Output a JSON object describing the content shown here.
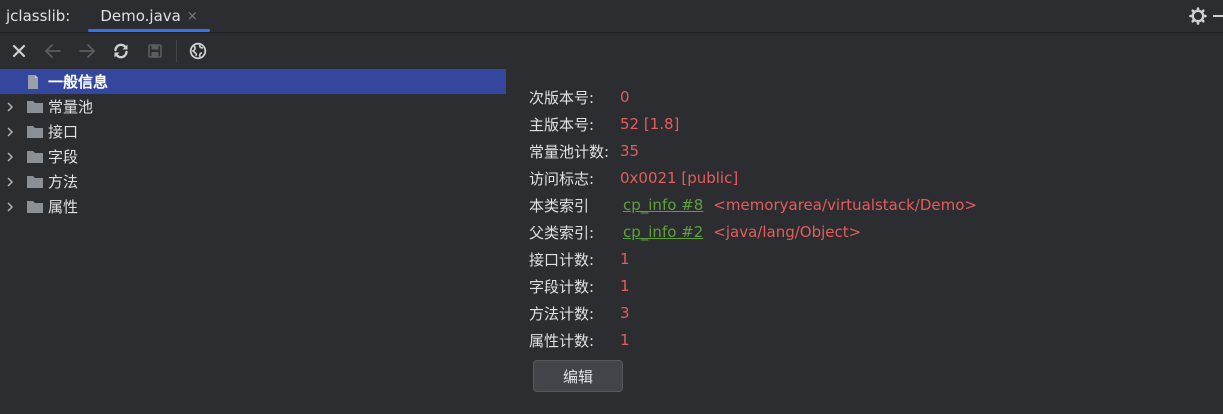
{
  "tool_window": {
    "title": "jclasslib:"
  },
  "tabs": [
    {
      "label": "Demo.java",
      "close": "×",
      "active": true
    }
  ],
  "toolbar": {
    "buttons": [
      {
        "icon": "close-icon",
        "enabled": true
      },
      {
        "icon": "arrow-left-icon",
        "enabled": false
      },
      {
        "icon": "arrow-right-icon",
        "enabled": false
      },
      {
        "icon": "refresh-icon",
        "enabled": true
      },
      {
        "icon": "save-icon",
        "enabled": false
      },
      {
        "icon": "globe-icon",
        "enabled": true
      }
    ]
  },
  "tree": {
    "items": [
      {
        "label": "一般信息",
        "selected": true,
        "expandable": false,
        "icon": "file-icon"
      },
      {
        "label": "常量池",
        "selected": false,
        "expandable": true,
        "icon": "folder-icon"
      },
      {
        "label": "接口",
        "selected": false,
        "expandable": true,
        "icon": "folder-icon"
      },
      {
        "label": "字段",
        "selected": false,
        "expandable": true,
        "icon": "folder-icon"
      },
      {
        "label": "方法",
        "selected": false,
        "expandable": true,
        "icon": "folder-icon"
      },
      {
        "label": "属性",
        "selected": false,
        "expandable": true,
        "icon": "folder-icon"
      }
    ]
  },
  "general_info": {
    "minor_version": {
      "label": "次版本号:",
      "value": "0"
    },
    "major_version": {
      "label": "主版本号:",
      "value": "52 [1.8]"
    },
    "constant_pool_count": {
      "label": "常量池计数:",
      "value": "35"
    },
    "access_flags": {
      "label": "访问标志:",
      "value": "0x0021 [public]"
    },
    "this_class": {
      "label": "本类索引",
      "link": "cp_info #8",
      "value": "<memoryarea/virtualstack/Demo>"
    },
    "super_class": {
      "label": "父类索引:",
      "link": "cp_info #2",
      "value": "<java/lang/Object>"
    },
    "interfaces_count": {
      "label": "接口计数:",
      "value": "1"
    },
    "fields_count": {
      "label": "字段计数:",
      "value": "1"
    },
    "methods_count": {
      "label": "方法计数:",
      "value": "3"
    },
    "attributes_count": {
      "label": "属性计数:",
      "value": "1"
    },
    "edit_button": "编辑"
  },
  "colors": {
    "background": "#2b2d30",
    "value_red": "#e65c5c",
    "link_green": "#5fa03d",
    "selection": "#3d48c8",
    "tab_underline": "#3574f0"
  }
}
